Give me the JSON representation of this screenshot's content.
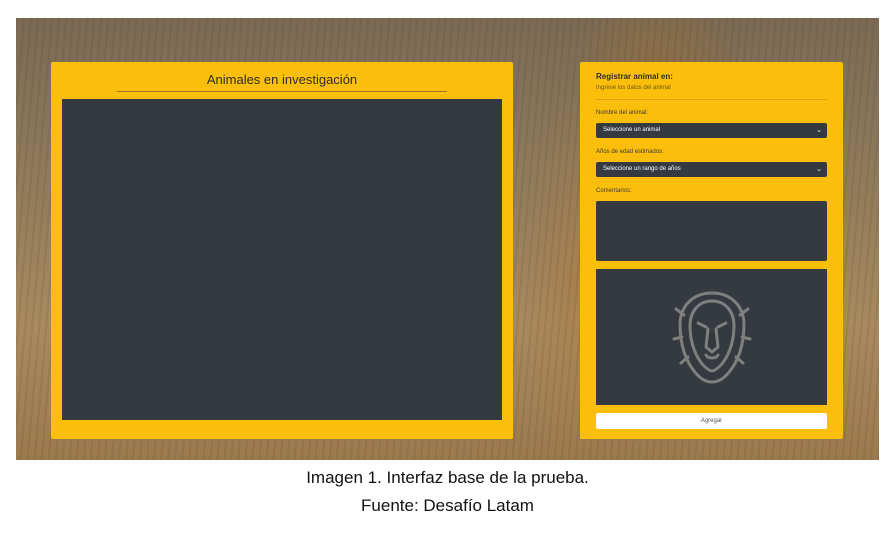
{
  "left_panel": {
    "title": "Animales en investigación"
  },
  "form": {
    "title": "Registrar animal en:",
    "subtitle": "Ingrese los datos del animal",
    "name_label": "Nombre del animal:",
    "name_selected": "Seleccione un animal",
    "age_label": "Años de edad estimados:",
    "age_selected": "Seleccione un rango de años",
    "comments_label": "Comentarios:",
    "comments_value": "",
    "submit_label": "Agregar"
  },
  "icons": {
    "chevron": "chevron-down-icon",
    "preview": "lion-icon"
  },
  "caption": {
    "line1": "Imagen 1. Interfaz base de la prueba.",
    "line2": "Fuente: Desafío Latam"
  },
  "colors": {
    "panel": "#fbbe0a",
    "dark": "#343a40",
    "button": "#ffffff"
  }
}
